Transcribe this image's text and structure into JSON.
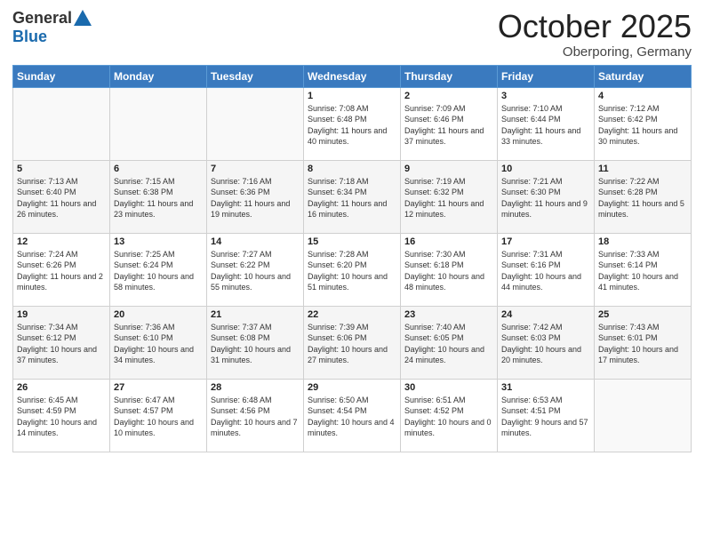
{
  "header": {
    "logo_general": "General",
    "logo_blue": "Blue",
    "month": "October 2025",
    "location": "Oberporing, Germany"
  },
  "weekdays": [
    "Sunday",
    "Monday",
    "Tuesday",
    "Wednesday",
    "Thursday",
    "Friday",
    "Saturday"
  ],
  "weeks": [
    [
      {
        "day": "",
        "info": ""
      },
      {
        "day": "",
        "info": ""
      },
      {
        "day": "",
        "info": ""
      },
      {
        "day": "1",
        "info": "Sunrise: 7:08 AM\nSunset: 6:48 PM\nDaylight: 11 hours\nand 40 minutes."
      },
      {
        "day": "2",
        "info": "Sunrise: 7:09 AM\nSunset: 6:46 PM\nDaylight: 11 hours\nand 37 minutes."
      },
      {
        "day": "3",
        "info": "Sunrise: 7:10 AM\nSunset: 6:44 PM\nDaylight: 11 hours\nand 33 minutes."
      },
      {
        "day": "4",
        "info": "Sunrise: 7:12 AM\nSunset: 6:42 PM\nDaylight: 11 hours\nand 30 minutes."
      }
    ],
    [
      {
        "day": "5",
        "info": "Sunrise: 7:13 AM\nSunset: 6:40 PM\nDaylight: 11 hours\nand 26 minutes."
      },
      {
        "day": "6",
        "info": "Sunrise: 7:15 AM\nSunset: 6:38 PM\nDaylight: 11 hours\nand 23 minutes."
      },
      {
        "day": "7",
        "info": "Sunrise: 7:16 AM\nSunset: 6:36 PM\nDaylight: 11 hours\nand 19 minutes."
      },
      {
        "day": "8",
        "info": "Sunrise: 7:18 AM\nSunset: 6:34 PM\nDaylight: 11 hours\nand 16 minutes."
      },
      {
        "day": "9",
        "info": "Sunrise: 7:19 AM\nSunset: 6:32 PM\nDaylight: 11 hours\nand 12 minutes."
      },
      {
        "day": "10",
        "info": "Sunrise: 7:21 AM\nSunset: 6:30 PM\nDaylight: 11 hours\nand 9 minutes."
      },
      {
        "day": "11",
        "info": "Sunrise: 7:22 AM\nSunset: 6:28 PM\nDaylight: 11 hours\nand 5 minutes."
      }
    ],
    [
      {
        "day": "12",
        "info": "Sunrise: 7:24 AM\nSunset: 6:26 PM\nDaylight: 11 hours\nand 2 minutes."
      },
      {
        "day": "13",
        "info": "Sunrise: 7:25 AM\nSunset: 6:24 PM\nDaylight: 10 hours\nand 58 minutes."
      },
      {
        "day": "14",
        "info": "Sunrise: 7:27 AM\nSunset: 6:22 PM\nDaylight: 10 hours\nand 55 minutes."
      },
      {
        "day": "15",
        "info": "Sunrise: 7:28 AM\nSunset: 6:20 PM\nDaylight: 10 hours\nand 51 minutes."
      },
      {
        "day": "16",
        "info": "Sunrise: 7:30 AM\nSunset: 6:18 PM\nDaylight: 10 hours\nand 48 minutes."
      },
      {
        "day": "17",
        "info": "Sunrise: 7:31 AM\nSunset: 6:16 PM\nDaylight: 10 hours\nand 44 minutes."
      },
      {
        "day": "18",
        "info": "Sunrise: 7:33 AM\nSunset: 6:14 PM\nDaylight: 10 hours\nand 41 minutes."
      }
    ],
    [
      {
        "day": "19",
        "info": "Sunrise: 7:34 AM\nSunset: 6:12 PM\nDaylight: 10 hours\nand 37 minutes."
      },
      {
        "day": "20",
        "info": "Sunrise: 7:36 AM\nSunset: 6:10 PM\nDaylight: 10 hours\nand 34 minutes."
      },
      {
        "day": "21",
        "info": "Sunrise: 7:37 AM\nSunset: 6:08 PM\nDaylight: 10 hours\nand 31 minutes."
      },
      {
        "day": "22",
        "info": "Sunrise: 7:39 AM\nSunset: 6:06 PM\nDaylight: 10 hours\nand 27 minutes."
      },
      {
        "day": "23",
        "info": "Sunrise: 7:40 AM\nSunset: 6:05 PM\nDaylight: 10 hours\nand 24 minutes."
      },
      {
        "day": "24",
        "info": "Sunrise: 7:42 AM\nSunset: 6:03 PM\nDaylight: 10 hours\nand 20 minutes."
      },
      {
        "day": "25",
        "info": "Sunrise: 7:43 AM\nSunset: 6:01 PM\nDaylight: 10 hours\nand 17 minutes."
      }
    ],
    [
      {
        "day": "26",
        "info": "Sunrise: 6:45 AM\nSunset: 4:59 PM\nDaylight: 10 hours\nand 14 minutes."
      },
      {
        "day": "27",
        "info": "Sunrise: 6:47 AM\nSunset: 4:57 PM\nDaylight: 10 hours\nand 10 minutes."
      },
      {
        "day": "28",
        "info": "Sunrise: 6:48 AM\nSunset: 4:56 PM\nDaylight: 10 hours\nand 7 minutes."
      },
      {
        "day": "29",
        "info": "Sunrise: 6:50 AM\nSunset: 4:54 PM\nDaylight: 10 hours\nand 4 minutes."
      },
      {
        "day": "30",
        "info": "Sunrise: 6:51 AM\nSunset: 4:52 PM\nDaylight: 10 hours\nand 0 minutes."
      },
      {
        "day": "31",
        "info": "Sunrise: 6:53 AM\nSunset: 4:51 PM\nDaylight: 9 hours\nand 57 minutes."
      },
      {
        "day": "",
        "info": ""
      }
    ]
  ]
}
